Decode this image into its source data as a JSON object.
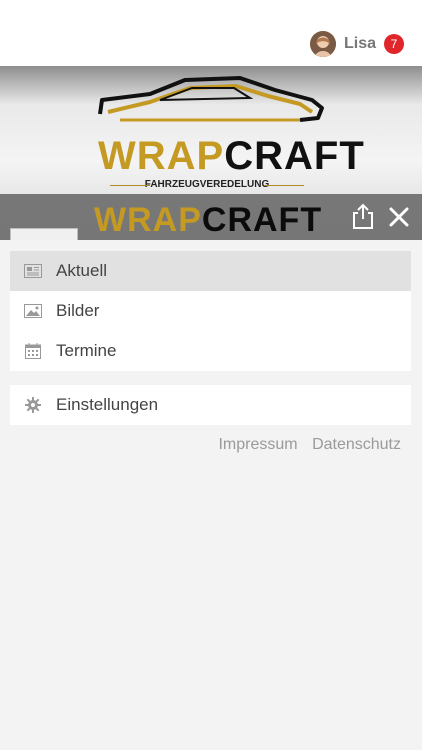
{
  "user": {
    "name": "Lisa",
    "notification_count": "7"
  },
  "brand": {
    "wordmark_part1": "WRAP",
    "wordmark_part2": "CRAFT",
    "subtitle": "FAHRZEUGVEREDELUNG"
  },
  "menu": {
    "items": [
      {
        "label": "Aktuell",
        "icon": "newspaper-icon",
        "active": true
      },
      {
        "label": "Bilder",
        "icon": "image-icon",
        "active": false
      },
      {
        "label": "Termine",
        "icon": "calendar-icon",
        "active": false
      }
    ],
    "settings": {
      "label": "Einstellungen",
      "icon": "gear-icon"
    }
  },
  "footer": {
    "impressum": "Impressum",
    "datenschutz": "Datenschutz"
  },
  "colors": {
    "badge": "#e0262b",
    "gold": "#c49a23",
    "header_overlay": "#6e6e6e",
    "active_item": "#e1e1e1"
  }
}
